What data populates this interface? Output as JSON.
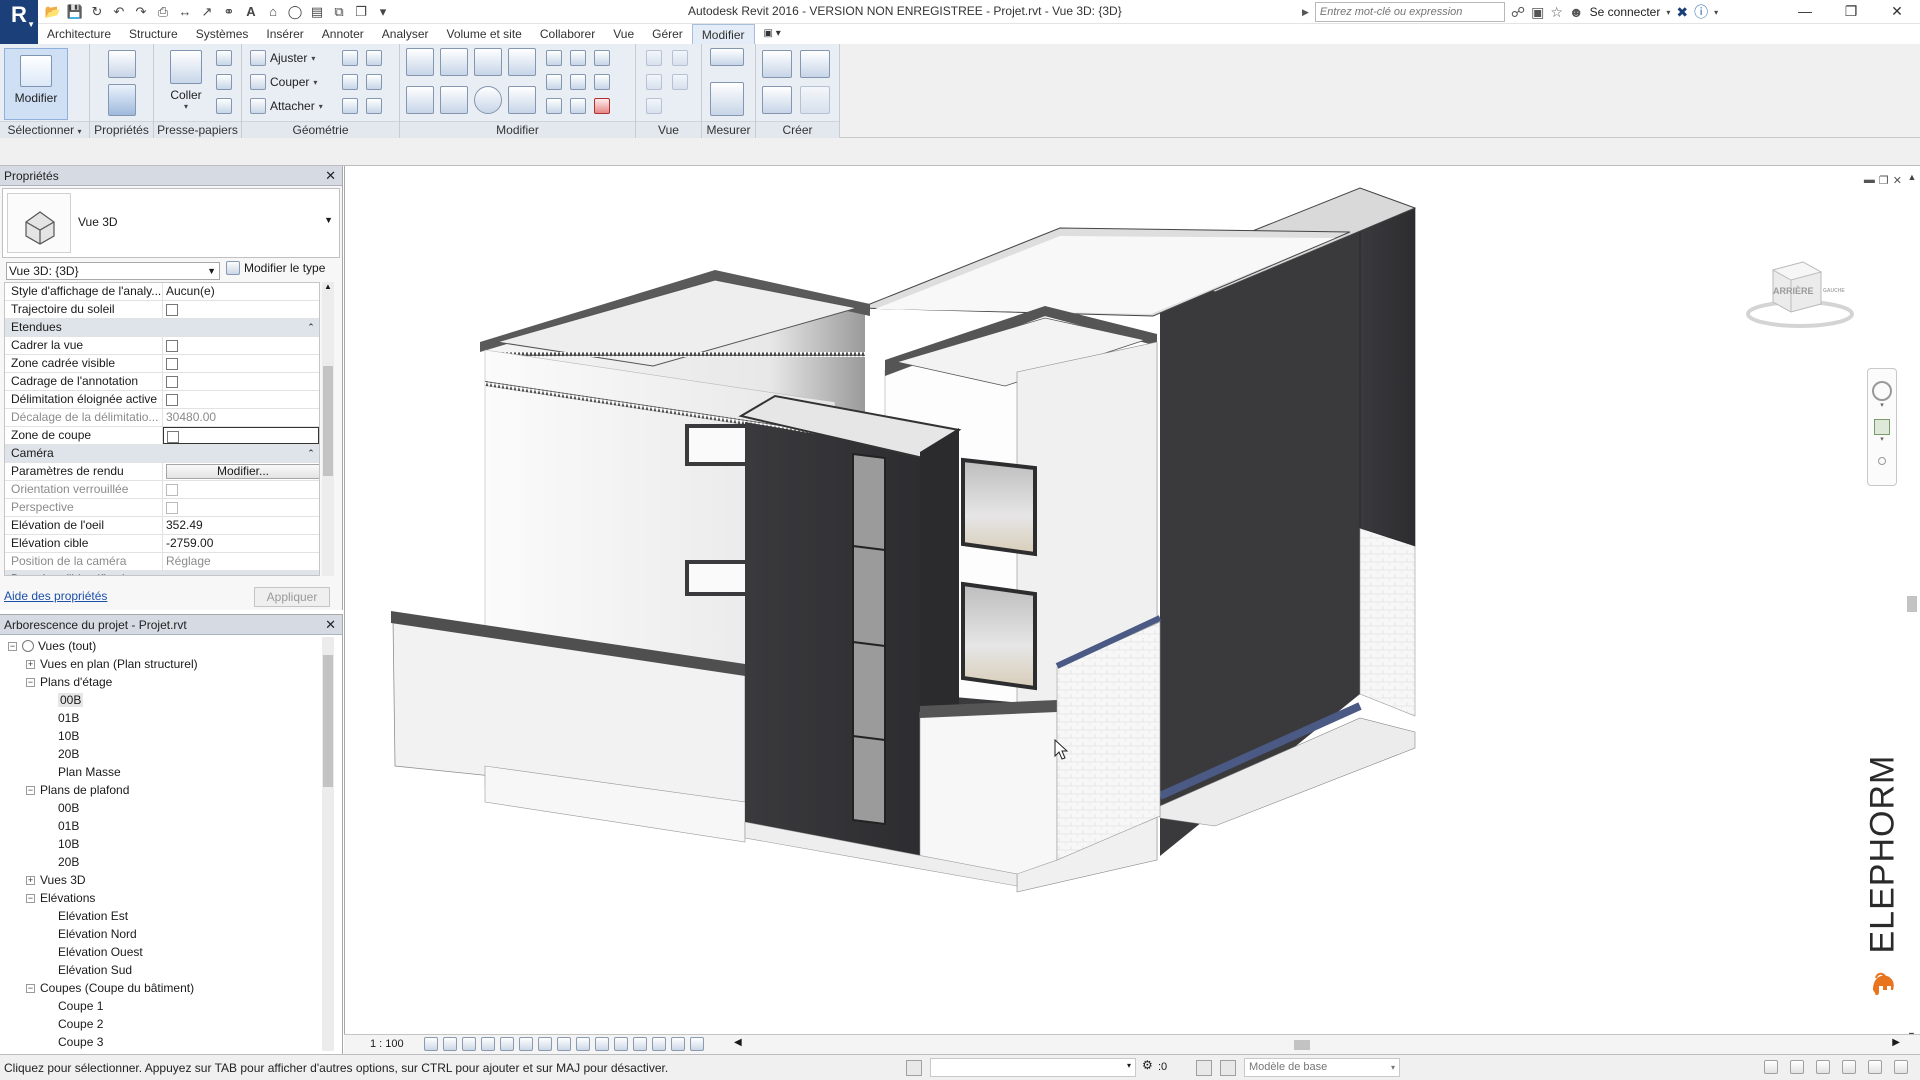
{
  "title_bar": {
    "title": "Autodesk Revit 2016 - VERSION NON ENREGISTREE -     Projet.rvt - Vue 3D: {3D}",
    "search_placeholder": "Entrez mot-clé ou expression",
    "sign_in": "Se connecter",
    "app_letter": "R"
  },
  "menu_tabs": [
    "Architecture",
    "Structure",
    "Systèmes",
    "Insérer",
    "Annoter",
    "Analyser",
    "Volume et site",
    "Collaborer",
    "Vue",
    "Gérer",
    "Modifier"
  ],
  "active_tab": "Modifier",
  "ribbon": {
    "select_label": "Sélectionner",
    "modify_label": "Modifier",
    "properties_panel": "Propriétés",
    "clipboard_panel": "Presse-papiers",
    "paste_label": "Coller",
    "geometry_panel": "Géométrie",
    "geometry_tools": [
      "Ajuster",
      "Couper",
      "Attacher"
    ],
    "modify_panel": "Modifier",
    "view_panel": "Vue",
    "measure_panel": "Mesurer",
    "create_panel": "Créer"
  },
  "properties": {
    "header": "Propriétés",
    "type_name": "Vue 3D",
    "instance_selector": "Vue 3D: {3D}",
    "edit_type": "Modifier le type",
    "rows": [
      {
        "kind": "prop",
        "name": "Style d'affichage de l'analy...",
        "value": "Aucun(e)"
      },
      {
        "kind": "prop",
        "name": "Trajectoire du soleil",
        "checkbox": true
      },
      {
        "kind": "group",
        "name": "Etendues"
      },
      {
        "kind": "prop",
        "name": "Cadrer la vue",
        "checkbox": true
      },
      {
        "kind": "prop",
        "name": "Zone cadrée visible",
        "checkbox": true
      },
      {
        "kind": "prop",
        "name": "Cadrage de l'annotation",
        "checkbox": true
      },
      {
        "kind": "prop",
        "name": "Délimitation éloignée active",
        "checkbox": true
      },
      {
        "kind": "prop",
        "name": "Décalage de la délimitatio...",
        "value": "30480.00",
        "disabled": true
      },
      {
        "kind": "prop",
        "name": "Zone de coupe",
        "checkbox": true,
        "selected": true
      },
      {
        "kind": "group",
        "name": "Caméra"
      },
      {
        "kind": "prop",
        "name": "Paramètres de rendu",
        "button": "Modifier..."
      },
      {
        "kind": "prop",
        "name": "Orientation verrouillée",
        "checkbox": true,
        "disabled": true
      },
      {
        "kind": "prop",
        "name": "Perspective",
        "checkbox": true,
        "disabled": true
      },
      {
        "kind": "prop",
        "name": "Elévation de l'oeil",
        "value": "352.49"
      },
      {
        "kind": "prop",
        "name": "Elévation cible",
        "value": "-2759.00"
      },
      {
        "kind": "prop",
        "name": "Position de la caméra",
        "value": "Réglage",
        "disabled": true
      },
      {
        "kind": "group",
        "name": "Données d'identification"
      }
    ],
    "help_link": "Aide des propriétés",
    "apply": "Appliquer"
  },
  "browser": {
    "header": "Arborescence du projet - Projet.rvt",
    "tree": [
      {
        "label": "Vues (tout)",
        "level": 0,
        "toggle": "-",
        "icon": true
      },
      {
        "label": "Vues en plan (Plan structurel)",
        "level": 1,
        "toggle": "+"
      },
      {
        "label": "Plans d'étage",
        "level": 1,
        "toggle": "-"
      },
      {
        "label": "00B",
        "level": 2,
        "highlight": true
      },
      {
        "label": "01B",
        "level": 2
      },
      {
        "label": "10B",
        "level": 2
      },
      {
        "label": "20B",
        "level": 2
      },
      {
        "label": "Plan Masse",
        "level": 2
      },
      {
        "label": "Plans de plafond",
        "level": 1,
        "toggle": "-"
      },
      {
        "label": "00B",
        "level": 2
      },
      {
        "label": "01B",
        "level": 2
      },
      {
        "label": "10B",
        "level": 2
      },
      {
        "label": "20B",
        "level": 2
      },
      {
        "label": "Vues 3D",
        "level": 1,
        "toggle": "+"
      },
      {
        "label": "Elévations",
        "level": 1,
        "toggle": "-"
      },
      {
        "label": "Elévation Est",
        "level": 2
      },
      {
        "label": "Elévation Nord",
        "level": 2
      },
      {
        "label": "Elévation Ouest",
        "level": 2
      },
      {
        "label": "Elévation Sud",
        "level": 2
      },
      {
        "label": "Coupes (Coupe du bâtiment)",
        "level": 1,
        "toggle": "-"
      },
      {
        "label": "Coupe 1",
        "level": 2
      },
      {
        "label": "Coupe 2",
        "level": 2
      },
      {
        "label": "Coupe 3",
        "level": 2
      }
    ]
  },
  "viewport": {
    "viewcube_label": "ARRIÈRE",
    "viewcube_side": "GAUCHE",
    "watermark": "ELEPHORM",
    "scale": "1 : 100"
  },
  "status": {
    "hint": "Cliquez pour sélectionner. Appuyez sur TAB pour afficher d'autres options, sur CTRL pour ajouter et sur MAJ pour désactiver.",
    "selection_count": ":0",
    "model": "Modèle de base"
  },
  "colors": {
    "app_blue": "#1b3f78",
    "dark_panel": "#3d3d40",
    "wall_light": "#f2f2f2",
    "logo_orange": "#e8741e",
    "accent_stripe": "#4a5a84"
  }
}
